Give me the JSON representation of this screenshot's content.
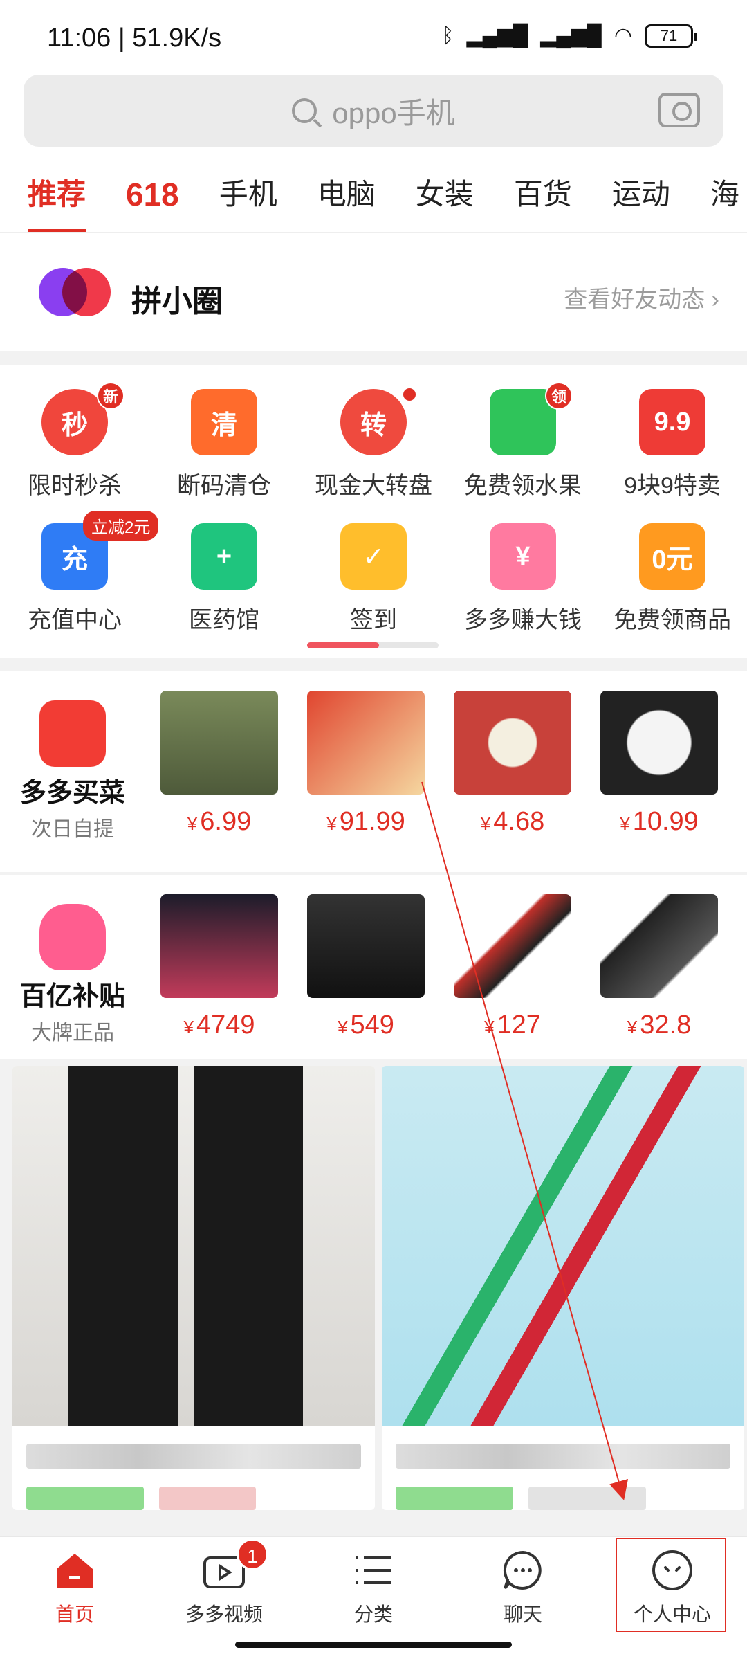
{
  "status": {
    "time": "11:06 | 51.9K/s",
    "battery": "71"
  },
  "search": {
    "placeholder": "oppo手机"
  },
  "tabs": [
    "推荐",
    "618",
    "手机",
    "电脑",
    "女装",
    "百货",
    "运动",
    "海"
  ],
  "pin": {
    "title": "拼小圈",
    "link": "查看好友动态 ›"
  },
  "grid": [
    {
      "label": "限时秒杀",
      "icon": "秒",
      "badge": "新",
      "color": "#f0463c"
    },
    {
      "label": "断码清仓",
      "icon": "清",
      "color": "#ff6b2c"
    },
    {
      "label": "现金大转盘",
      "icon": "转",
      "color": "#ef4a3e"
    },
    {
      "label": "免费领水果",
      "icon": "",
      "badge": "领",
      "color": "#2fc45a"
    },
    {
      "label": "9块9特卖",
      "icon": "9.9",
      "color": "#ee3b36"
    },
    {
      "label": "充值中心",
      "icon": "充",
      "pill": "立减2元",
      "color": "#2f7cf5"
    },
    {
      "label": "医药馆",
      "icon": "+",
      "color": "#1fc57e"
    },
    {
      "label": "签到",
      "icon": "✓",
      "color": "#ffbe2c"
    },
    {
      "label": "多多赚大钱",
      "icon": "¥",
      "color": "#ff7aa0"
    },
    {
      "label": "免费领商品",
      "icon": "0元",
      "color": "#ff9a1f"
    }
  ],
  "maicai": {
    "title": "多多买菜",
    "sub": "次日自提",
    "prices": [
      "6.99",
      "91.99",
      "4.68",
      "10.99"
    ]
  },
  "butie": {
    "title": "百亿补贴",
    "sub": "大牌正品",
    "prices": [
      "4749",
      "549",
      "127",
      "32.8"
    ]
  },
  "currency": "¥",
  "nav": [
    {
      "label": "首页"
    },
    {
      "label": "多多视频",
      "badge": "1"
    },
    {
      "label": "分类"
    },
    {
      "label": "聊天"
    },
    {
      "label": "个人中心"
    }
  ]
}
